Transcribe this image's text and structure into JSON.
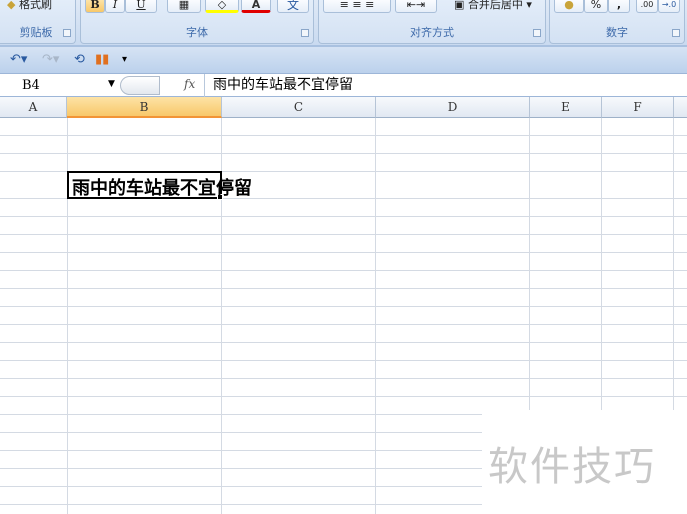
{
  "ribbon": {
    "clipboard": {
      "label": "剪贴板",
      "format_painter": "格式刷"
    },
    "font": {
      "label": "字体",
      "bold": "B",
      "italic": "I",
      "underline": "U",
      "font_color": "A",
      "phonetic": "文"
    },
    "alignment": {
      "label": "对齐方式",
      "merge_center": "合并后居中"
    },
    "number": {
      "label": "数字",
      "percent": "%",
      "comma": ",",
      "increase_decimal": ".00",
      "decrease_decimal": "→.0"
    }
  },
  "formula_bar": {
    "name_box": "B4",
    "fx": "fx",
    "value": "雨中的车站最不宜停留"
  },
  "columns": [
    "A",
    "B",
    "C",
    "D",
    "E",
    "F"
  ],
  "selected_column": "B",
  "cells": {
    "B4": "雨中的车站最不宜停留"
  },
  "watermark": "软件技巧"
}
